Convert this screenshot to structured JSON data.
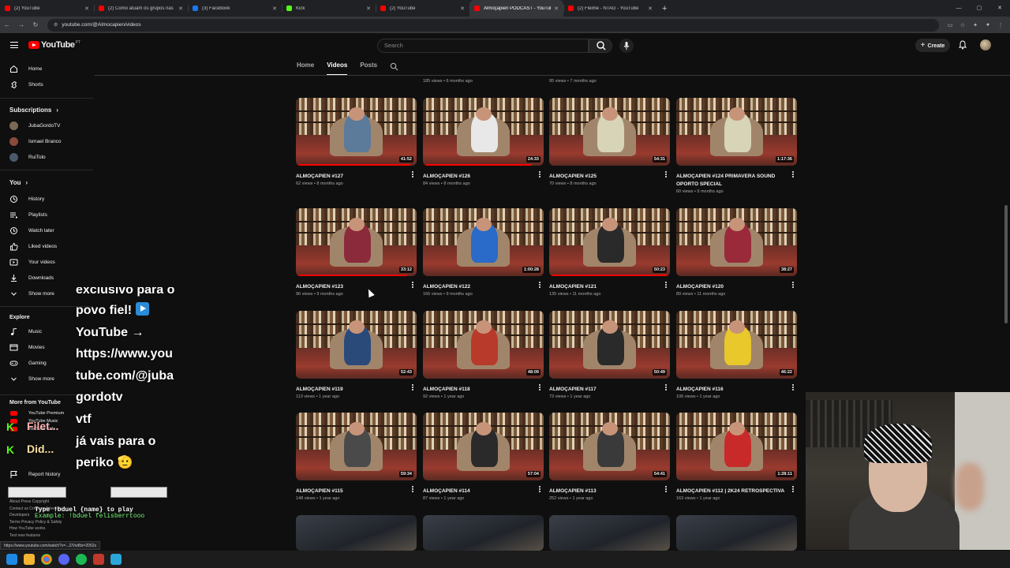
{
  "browser": {
    "tabs": [
      {
        "title": "(2) YouTube",
        "color": "#ff0000"
      },
      {
        "title": "(2) Como atuam os grupos nas",
        "color": "#ff0000"
      },
      {
        "title": "(3) Facebook",
        "color": "#1877f2"
      },
      {
        "title": "Kick",
        "color": "#53fc18"
      },
      {
        "title": "(2) YouTube",
        "color": "#ff0000"
      },
      {
        "title": "Almoçapien PODCAST - YouTube",
        "color": "#ff0000",
        "active": true
      },
      {
        "title": "(2) Fleime - NTAG - YouTube",
        "color": "#ff0000"
      }
    ],
    "url": "youtube.com/@Almocapien/videos",
    "status_url": "https://www.youtube.com/watch?v=...Z/Vw8ts=2052s"
  },
  "header": {
    "logo_text": "YouTube",
    "country_code": "PT",
    "search_placeholder": "Search",
    "create_label": "Create"
  },
  "sidebar": {
    "top": [
      {
        "label": "Home",
        "icon": "home-icon"
      },
      {
        "label": "Shorts",
        "icon": "shorts-icon"
      }
    ],
    "subscriptions_title": "Subscriptions",
    "subscriptions": [
      {
        "label": "JubaGordoTV",
        "color": "#7a6a55"
      },
      {
        "label": "Ismael Branco",
        "color": "#8a4a3a"
      },
      {
        "label": "RuiTolo",
        "color": "#4a5a6a"
      }
    ],
    "you_title": "You",
    "you": [
      {
        "label": "History",
        "icon": "history-icon"
      },
      {
        "label": "Playlists",
        "icon": "playlists-icon"
      },
      {
        "label": "Watch later",
        "icon": "watch-later-icon"
      },
      {
        "label": "Liked videos",
        "icon": "like-icon"
      },
      {
        "label": "Your videos",
        "icon": "your-videos-icon"
      },
      {
        "label": "Downloads",
        "icon": "download-icon"
      },
      {
        "label": "Show more",
        "icon": "chevron-down-icon"
      }
    ],
    "explore_title": "Explore",
    "explore": [
      {
        "label": "Music",
        "icon": "music-icon"
      },
      {
        "label": "Movies",
        "icon": "movies-icon"
      },
      {
        "label": "Gaming",
        "icon": "gaming-icon"
      },
      {
        "label": "Show more",
        "icon": "chevron-down-icon"
      }
    ],
    "more_title": "More from YouTube",
    "more": [
      {
        "label": "YouTube Premium"
      },
      {
        "label": "YouTube Music"
      },
      {
        "label": "YouTube Kids"
      }
    ],
    "report_history": "Report history",
    "footer_lines": [
      "About  Press  Copyright",
      "Contact us  Creators  Advertise",
      "Developers",
      "Terms  Privacy  Policy & Safety",
      "How YouTube works",
      "Test new features"
    ]
  },
  "chat_overlay": {
    "lines": [
      "exclusivo para o",
      "povo fiel!",
      "YouTube →",
      "https://www.you",
      "tube.com/@juba",
      "gordotv",
      "vtf",
      "já vais para o",
      "periko 🫡"
    ],
    "users": [
      "Filet...",
      "Did..."
    ],
    "duel_line1": "Type !bduel {name} to play",
    "duel_line2": "Example: !bduel felisberrtooo"
  },
  "channel_tabs": [
    "Home",
    "Videos",
    "Posts"
  ],
  "active_tab": "Videos",
  "prev_row_meta": [
    "185 views • 6 months ago",
    "95 views • 7 months ago"
  ],
  "videos": [
    {
      "title": "ALMOÇAPIEN #127",
      "meta": "62 views • 8 months ago",
      "duration": "41:52",
      "progress": 0.95,
      "shirt": "#5c7a9a"
    },
    {
      "title": "ALMOÇAPIEN #126",
      "meta": "84 views • 8 months ago",
      "duration": "24:33",
      "progress": 0.9,
      "shirt": "#e8e8e8"
    },
    {
      "title": "ALMOÇAPIEN #125",
      "meta": "70 views • 8 months ago",
      "duration": "54:31",
      "progress": 0.0,
      "shirt": "#d8d4b8"
    },
    {
      "title": "ALMOÇAPIEN #124 PRIMAVERA SOUND OPORTO SPECIAL",
      "meta": "60 views • 9 months ago",
      "duration": "1:17:36",
      "progress": 0.0,
      "shirt": "#d8d4b8"
    },
    {
      "title": "ALMOÇAPIEN #123",
      "meta": "96 views • 9 months ago",
      "duration": "33:12",
      "progress": 0.92,
      "shirt": "#8b2a3a"
    },
    {
      "title": "ALMOÇAPIEN #122",
      "meta": "166 views • 9 months ago",
      "duration": "1:00:28",
      "progress": 0.0,
      "shirt": "#2a6ac8"
    },
    {
      "title": "ALMOÇAPIEN #121",
      "meta": "135 views • 11 months ago",
      "duration": "50:23",
      "progress": 1.0,
      "shirt": "#2a2a2a"
    },
    {
      "title": "ALMOÇAPIEN #120",
      "meta": "89 views • 11 months ago",
      "duration": "38:27",
      "progress": 0.0,
      "shirt": "#9a2a3a"
    },
    {
      "title": "ALMOÇAPIEN #119",
      "meta": "113 views • 1 year ago",
      "duration": "52:43",
      "progress": 0.0,
      "shirt": "#2a4a7a"
    },
    {
      "title": "ALMOÇAPIEN #118",
      "meta": "92 views • 1 year ago",
      "duration": "48:09",
      "progress": 0.0,
      "shirt": "#b83a2a"
    },
    {
      "title": "ALMOÇAPIEN #117",
      "meta": "73 views • 1 year ago",
      "duration": "50:49",
      "progress": 0.0,
      "shirt": "#2a2a2a"
    },
    {
      "title": "ALMOÇAPIEN #116",
      "meta": "106 views • 1 year ago",
      "duration": "46:22",
      "progress": 0.0,
      "shirt": "#e8c82a"
    },
    {
      "title": "ALMOÇAPIEN #115",
      "meta": "148 views • 1 year ago",
      "duration": "59:34",
      "progress": 0.0,
      "shirt": "#4a4a4a"
    },
    {
      "title": "ALMOÇAPIEN #114",
      "meta": "87 views • 1 year ago",
      "duration": "57:04",
      "progress": 0.0,
      "shirt": "#2a2a2a"
    },
    {
      "title": "ALMOÇAPIEN #113",
      "meta": "252 views • 1 year ago",
      "duration": "54:41",
      "progress": 0.0,
      "shirt": "#3a3a3a"
    },
    {
      "title": "ALMOÇAPIEN #112 | 2K24 RETROSPECTIVA",
      "meta": "163 views • 1 year ago",
      "duration": "1:28:11",
      "progress": 0.0,
      "shirt": "#c82a2a"
    }
  ]
}
